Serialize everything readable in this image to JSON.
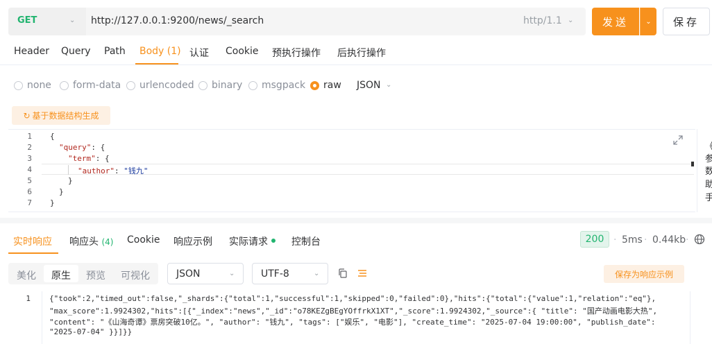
{
  "request": {
    "method": "GET",
    "url": "http://127.0.0.1:9200/news/_search",
    "protocol": "http/1.1",
    "send_label": "发送",
    "save_label": "保存"
  },
  "request_tabs": [
    "Header",
    "Query",
    "Path",
    "Body (1)",
    "认证",
    "Cookie",
    "预执行操作",
    "后执行操作"
  ],
  "active_request_tab": "Body (1)",
  "body_types": [
    "none",
    "form-data",
    "urlencoded",
    "binary",
    "msgpack",
    "raw"
  ],
  "selected_body_type": "raw",
  "raw_format": "JSON",
  "generate_button": "基于数据结构生成",
  "editor": {
    "line_numbers": [
      "1",
      "2",
      "3",
      "4",
      "5",
      "6",
      "7"
    ],
    "l1": "{",
    "l2_key": "\"query\"",
    "l2_rest": ": {",
    "l3_key": "\"term\"",
    "l3_rest": ": {",
    "l4_key": "\"author\"",
    "l4_sep": ": ",
    "l4_val": "\"钱九\"",
    "l5": "}",
    "l6": "}",
    "l7": "}"
  },
  "side_panel_chars": [
    "《",
    "参",
    "数",
    "助",
    "手"
  ],
  "response_tabs": {
    "live": "实时响应",
    "headers": "响应头",
    "headers_count": "(4)",
    "cookie": "Cookie",
    "example": "响应示例",
    "actual": "实际请求",
    "console": "控制台"
  },
  "status": {
    "code": "200",
    "time": "5ms",
    "size": "0.44kb"
  },
  "view_modes": [
    "美化",
    "原生",
    "预览",
    "可视化"
  ],
  "active_view_mode": "原生",
  "format_select": "JSON",
  "encoding_select": "UTF-8",
  "save_as_example": "保存为响应示例",
  "response_body": {
    "line_number": "1",
    "line1": "{\"took\":2,\"timed_out\":false,\"_shards\":{\"total\":1,\"successful\":1,\"skipped\":0,\"failed\":0},\"hits\":{\"total\":{\"value\":1,\"relation\":\"eq\"},",
    "line2": "\"max_score\":1.9924302,\"hits\":[{\"_index\":\"news\",\"_id\":\"o78KEZgBEgYOffrkX1XT\",\"_score\":1.9924302,\"_source\":{ \"title\": \"国产动画电影大热\",",
    "line3": "\"content\": \"《山海奇谭》票房突破10亿。\", \"author\": \"钱九\", \"tags\": [\"娱乐\", \"电影\"], \"create_time\": \"2025-07-04 19:00:00\", \"publish_date\":",
    "line4": "\"2025-07-04\" }}]}}"
  },
  "colors": {
    "accent": "#f7911d",
    "method_get": "#21b46f",
    "status_ok": "#21b46f"
  }
}
